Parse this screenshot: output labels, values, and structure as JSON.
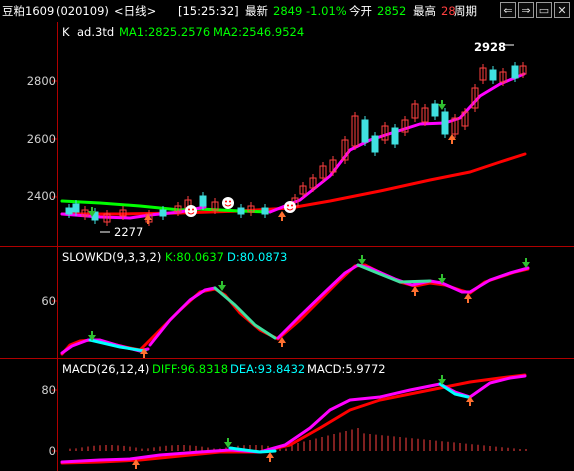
{
  "header": {
    "name": "豆粕1609",
    "code": "(020109)",
    "period": "<日线>",
    "time": "[15:25:32]",
    "latest_label": "最新",
    "latest_value": "2849",
    "change_pct": "-1.01%",
    "open_label": "今开",
    "open_value": "2852",
    "high_label": "最高",
    "high_value": "28",
    "cycle_label": "周期",
    "nav_buttons": [
      {
        "icon": "prev-arrow-icon",
        "glyph": "⇐"
      },
      {
        "icon": "next-arrow-icon",
        "glyph": "⇒"
      },
      {
        "icon": "window-icon",
        "glyph": "▭"
      },
      {
        "icon": "close-icon",
        "glyph": "✕"
      }
    ]
  },
  "panels": {
    "k": {
      "title": "K",
      "indicator": "ad.3td",
      "ma1": "MA1:2825.2576",
      "ma2": "MA2:2546.9524",
      "max_label": "2928",
      "min_label": "2277",
      "axis": [
        "2800",
        "2600",
        "2400"
      ]
    },
    "kd": {
      "title": "SLOWKD(9,3,3,2)",
      "k": "K:80.0637",
      "d": "D:80.0873",
      "axis": [
        "60"
      ]
    },
    "macd": {
      "title": "MACD(26,12,4)",
      "diff": "DIFF:96.8318",
      "dea": "DEA:93.8432",
      "macd": "MACD:5.9772",
      "axis": [
        "80",
        "0"
      ]
    }
  },
  "colors": {
    "up": "#ff4040",
    "down": "#40e0e0",
    "ma1": "#ff00ff",
    "ma2": "#ff0000",
    "frame": "#b00000",
    "label_green": "#00ff00",
    "label_cyan": "#00ffff",
    "label_yellow": "#ffff00",
    "label_magenta": "#ff00ff",
    "text_white": "#ffffff",
    "axis_text": "#d0d0d0"
  }
}
